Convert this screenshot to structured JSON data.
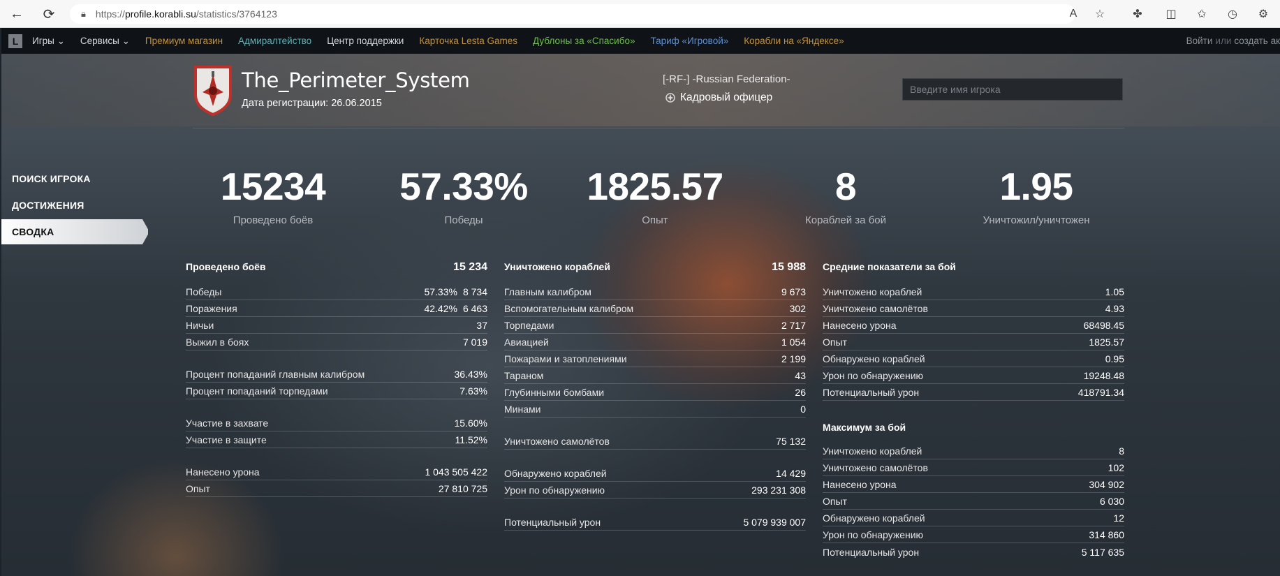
{
  "browser": {
    "url_prefix": "https://",
    "url_host": "profile.korabli.su",
    "url_path": "/statistics/3764123"
  },
  "topbar": {
    "logo": "L",
    "links": [
      {
        "label": "Игры ⌄",
        "color": "#d5d8dc"
      },
      {
        "label": "Сервисы ⌄",
        "color": "#d5d8dc"
      },
      {
        "label": "Премиум магазин",
        "color": "#c5913b"
      },
      {
        "label": "Адмиралтейство",
        "color": "#5fb0b5"
      },
      {
        "label": "Центр поддержки",
        "color": "#d5d8dc"
      },
      {
        "label": "Карточка Lesta Games",
        "color": "#c5913b"
      },
      {
        "label": "Дублоны за «Спасибо»",
        "color": "#6cc04a"
      },
      {
        "label": "Тариф «Игровой»",
        "color": "#5b8fd6"
      },
      {
        "label": "Корабли на «Яндексе»",
        "color": "#c5913b"
      }
    ],
    "login": "Войти",
    "or": "или",
    "register": "создать ак"
  },
  "player": {
    "name": "The_Perimeter_System",
    "reg_date": "Дата регистрации: 26.06.2015",
    "clan": "[-RF-] -Russian Federation-",
    "rank": "Кадровый офицер"
  },
  "search": {
    "placeholder": "Введите имя игрока"
  },
  "sidebar": {
    "items": [
      {
        "label": "ПОИСК ИГРОКА",
        "active": false
      },
      {
        "label": "ДОСТИЖЕНИЯ",
        "active": false
      },
      {
        "label": "СВОДКА",
        "active": true
      }
    ]
  },
  "summary": [
    {
      "value": "15234",
      "label": "Проведено боёв"
    },
    {
      "value": "57.33%",
      "label": "Победы"
    },
    {
      "value": "1825.57",
      "label": "Опыт"
    },
    {
      "value": "8",
      "label": "Кораблей за бой"
    },
    {
      "value": "1.95",
      "label": "Уничтожил/уничтожен"
    }
  ],
  "battles": {
    "title": "Проведено боёв",
    "total": "15 234",
    "group1": [
      {
        "label": "Победы",
        "pct": "57.33%",
        "value": "8 734"
      },
      {
        "label": "Поражения",
        "pct": "42.42%",
        "value": "6 463"
      },
      {
        "label": "Ничьи",
        "pct": "",
        "value": "37"
      },
      {
        "label": "Выжил в боях",
        "pct": "",
        "value": "7 019"
      }
    ],
    "group2": [
      {
        "label": "Процент попаданий главным калибром",
        "value": "36.43%"
      },
      {
        "label": "Процент попаданий торпедами",
        "value": "7.63%"
      }
    ],
    "group3": [
      {
        "label": "Участие в захвате",
        "value": "15.60%"
      },
      {
        "label": "Участие в защите",
        "value": "11.52%"
      }
    ],
    "group4": [
      {
        "label": "Нанесено урона",
        "value": "1 043 505 422"
      },
      {
        "label": "Опыт",
        "value": "27 810 725"
      }
    ]
  },
  "kills": {
    "title": "Уничтожено кораблей",
    "total": "15 988",
    "rows": [
      {
        "label": "Главным калибром",
        "value": "9 673"
      },
      {
        "label": "Вспомогательным калибром",
        "value": "302"
      },
      {
        "label": "Торпедами",
        "value": "2 717"
      },
      {
        "label": "Авиацией",
        "value": "1 054"
      },
      {
        "label": "Пожарами и затоплениями",
        "value": "2 199"
      },
      {
        "label": "Тараном",
        "value": "43"
      },
      {
        "label": "Глубинными бомбами",
        "value": "26"
      },
      {
        "label": "Минами",
        "value": "0"
      }
    ],
    "planes": {
      "label": "Уничтожено самолётов",
      "value": "75 132"
    },
    "spotted": [
      {
        "label": "Обнаружено кораблей",
        "value": "14 429"
      },
      {
        "label": "Урон по обнаружению",
        "value": "293 231 308"
      }
    ],
    "potential": {
      "label": "Потенциальный урон",
      "value": "5 079 939 007"
    }
  },
  "averages": {
    "title": "Средние показатели за бой",
    "rows": [
      {
        "label": "Уничтожено кораблей",
        "value": "1.05"
      },
      {
        "label": "Уничтожено самолётов",
        "value": "4.93"
      },
      {
        "label": "Нанесено урона",
        "value": "68498.45"
      },
      {
        "label": "Опыт",
        "value": "1825.57"
      },
      {
        "label": "Обнаружено кораблей",
        "value": "0.95"
      },
      {
        "label": "Урон по обнаружению",
        "value": "19248.48"
      },
      {
        "label": "Потенциальный урон",
        "value": "418791.34"
      }
    ]
  },
  "maximum": {
    "title": "Максимум за бой",
    "rows": [
      {
        "label": "Уничтожено кораблей",
        "value": "8"
      },
      {
        "label": "Уничтожено самолётов",
        "value": "102"
      },
      {
        "label": "Нанесено урона",
        "value": "304 902"
      },
      {
        "label": "Опыт",
        "value": "6 030"
      },
      {
        "label": "Обнаружено кораблей",
        "value": "12"
      },
      {
        "label": "Урон по обнаружению",
        "value": "314 860"
      },
      {
        "label": "Потенциальный урон",
        "value": "5 117 635"
      }
    ]
  }
}
